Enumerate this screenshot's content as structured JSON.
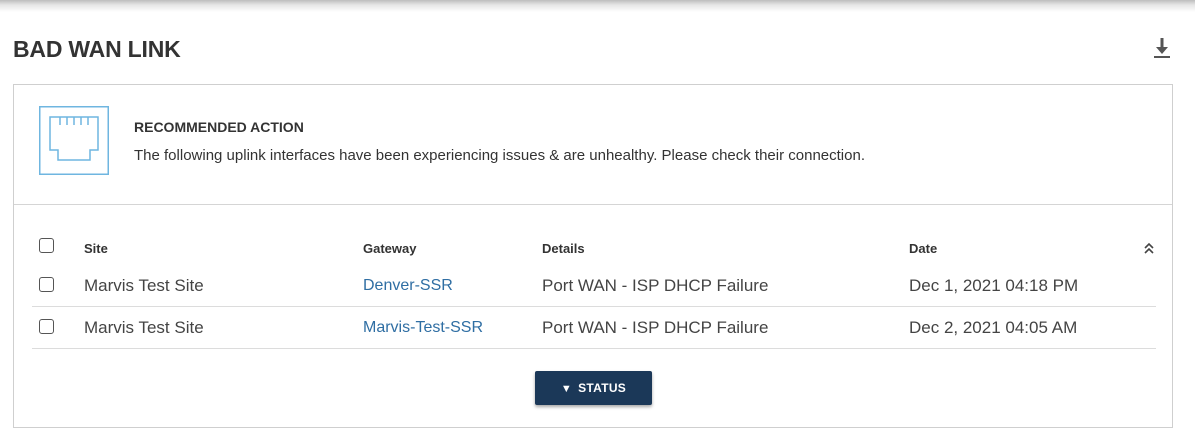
{
  "panel": {
    "title": "BAD WAN LINK",
    "download_icon": "download-icon"
  },
  "recommendation": {
    "icon": "ethernet-port-icon",
    "title": "RECOMMENDED ACTION",
    "text": "The following uplink interfaces have been experiencing issues & are unhealthy. Please check their connection."
  },
  "table": {
    "columns": {
      "site": "Site",
      "gateway": "Gateway",
      "details": "Details",
      "date": "Date"
    },
    "collapse_icon": "double-chevron-up-icon",
    "rows": [
      {
        "site": "Marvis Test Site",
        "gateway": "Denver-SSR",
        "details": "Port WAN - ISP DHCP Failure",
        "date": "Dec 1, 2021 04:18 PM",
        "checked": false
      },
      {
        "site": "Marvis Test Site",
        "gateway": "Marvis-Test-SSR",
        "details": "Port WAN - ISP DHCP Failure",
        "date": "Dec 2, 2021 04:05 AM",
        "checked": false
      }
    ]
  },
  "status_button": {
    "label": "STATUS",
    "icon": "triangle-down-icon"
  },
  "colors": {
    "link": "#2f6ea3",
    "button_bg": "#1b3858",
    "icon_blue": "#6fb6e0"
  }
}
